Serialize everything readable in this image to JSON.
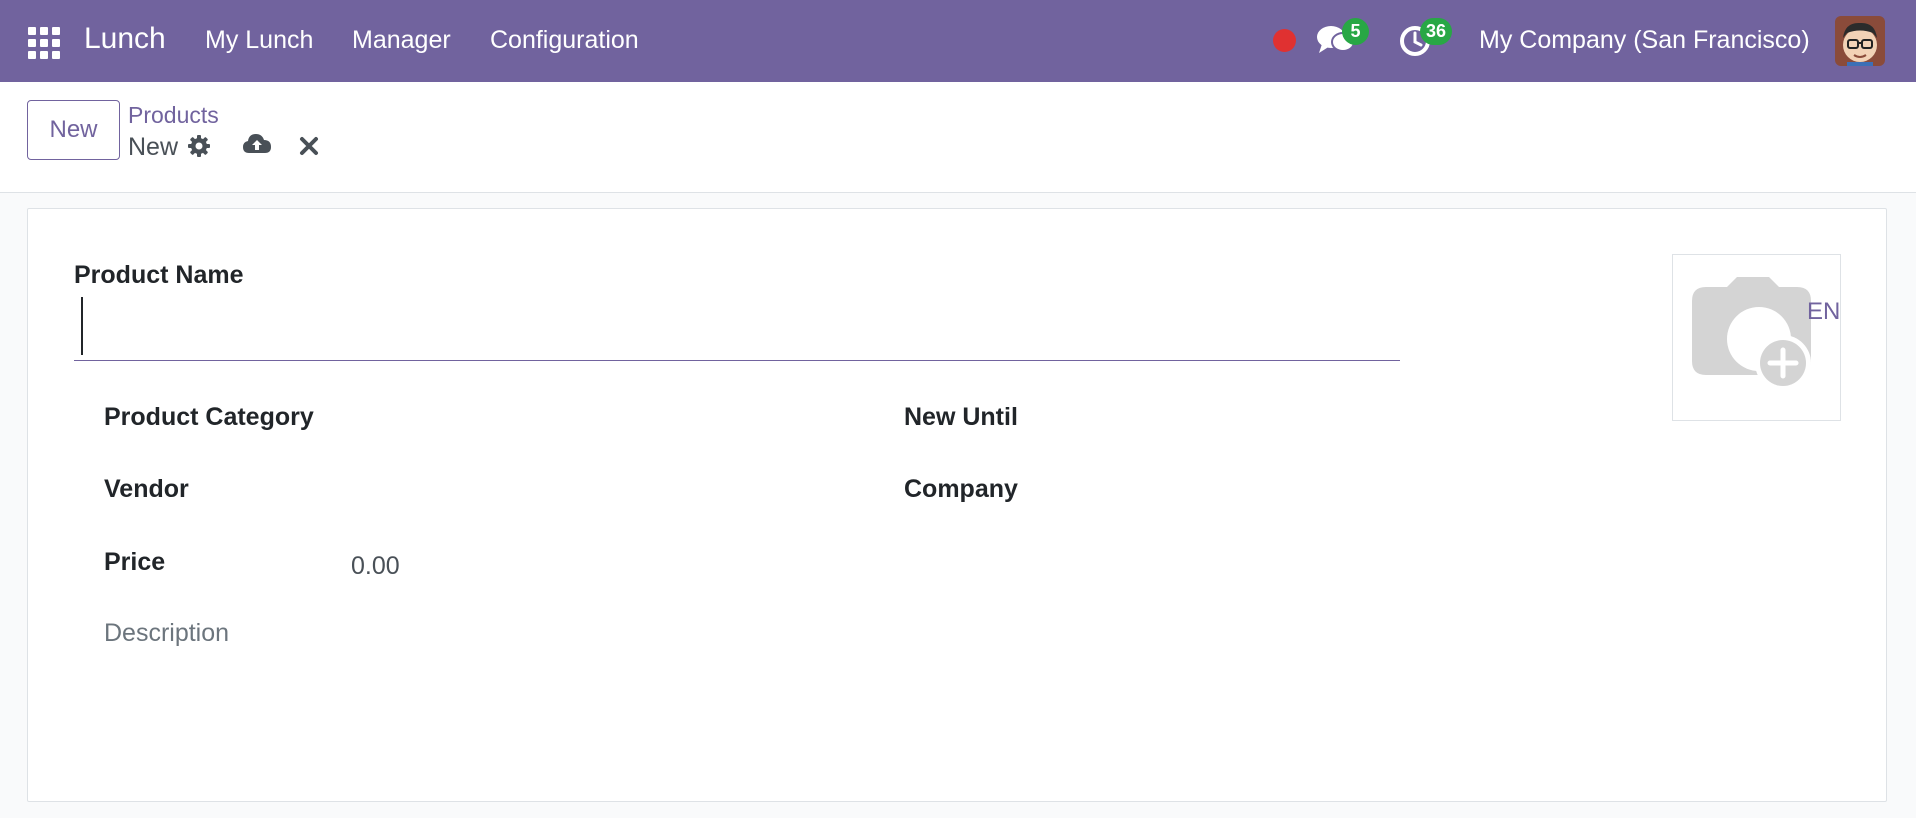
{
  "navbar": {
    "app_name": "Lunch",
    "menu": [
      "My Lunch",
      "Manager",
      "Configuration"
    ],
    "messages_count": "5",
    "activities_count": "36",
    "company": "My Company (San Francisco)"
  },
  "control_panel": {
    "new_label": "New",
    "breadcrumb_parent": "Products",
    "breadcrumb_current": "New"
  },
  "form": {
    "product_name_label": "Product Name",
    "product_name_value": "",
    "product_category_label": "Product Category",
    "vendor_label": "Vendor",
    "price_label": "Price",
    "price_value": "0.00",
    "new_until_label": "New Until",
    "company_label": "Company",
    "description_placeholder": "Description",
    "lang_label": "EN"
  },
  "colors": {
    "brand": "#71639e",
    "badge": "#28a745",
    "record": "#e03131"
  }
}
